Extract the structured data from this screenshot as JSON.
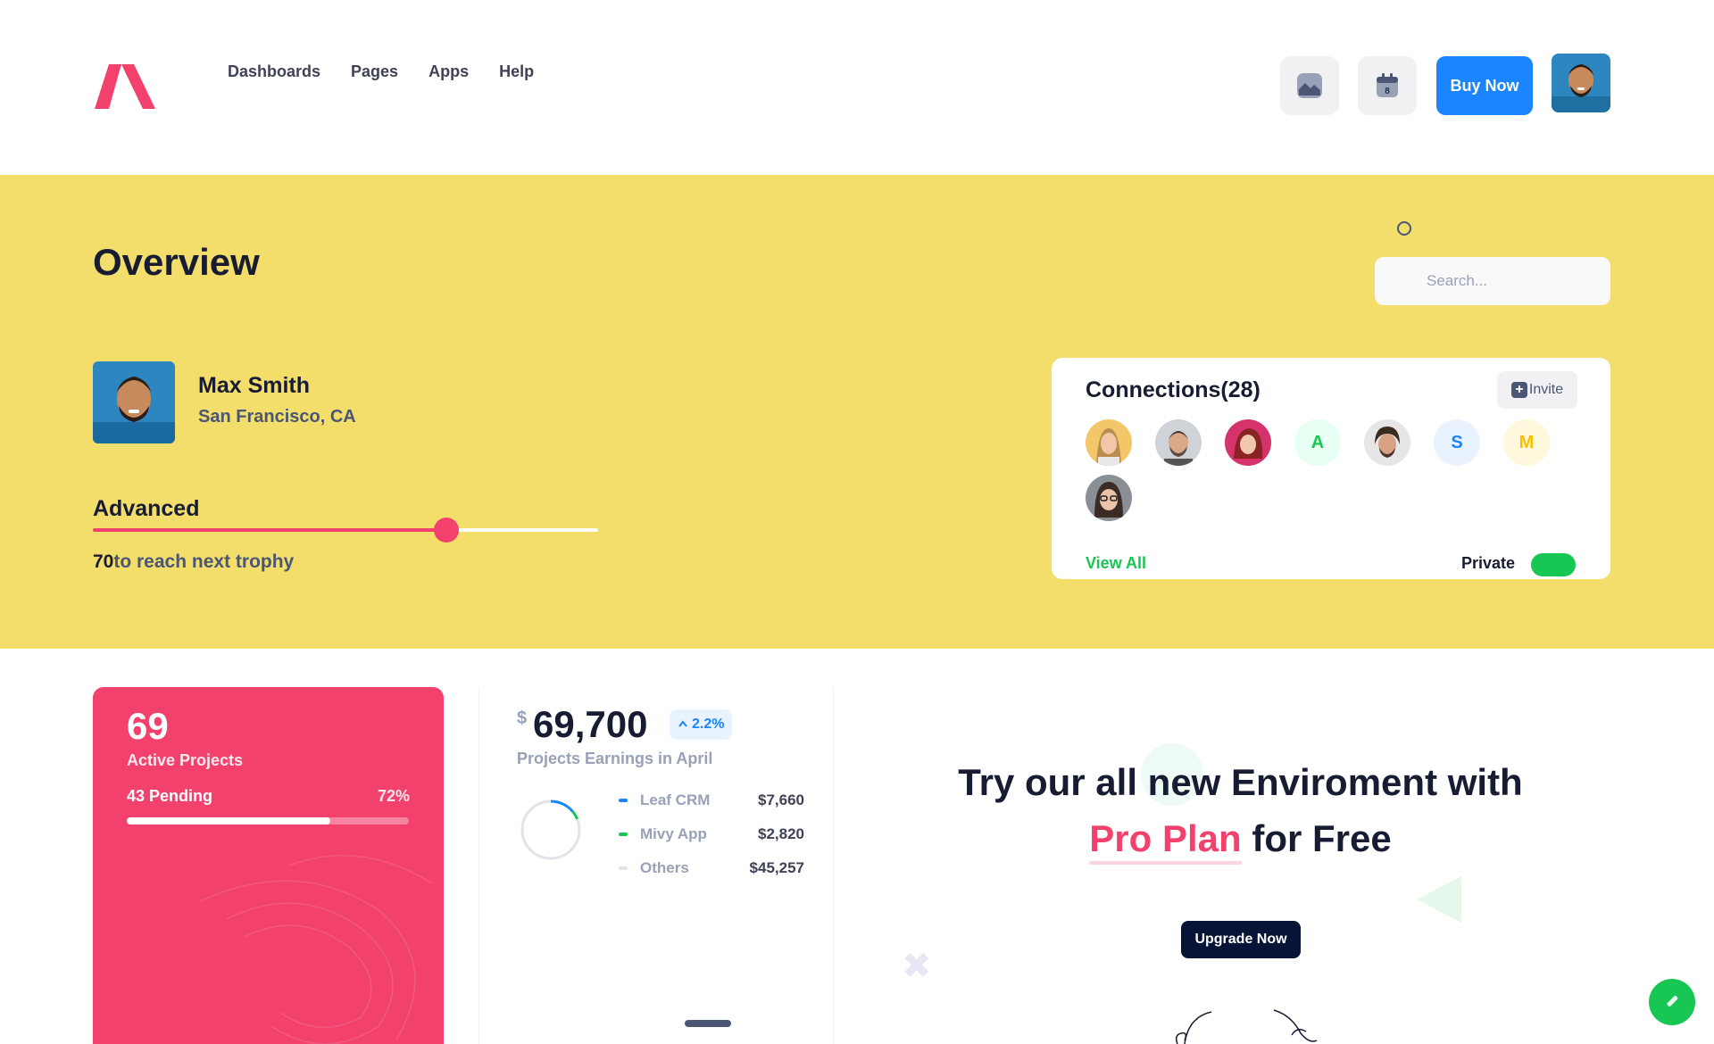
{
  "header": {
    "nav": [
      "Dashboards",
      "Pages",
      "Apps",
      "Help"
    ],
    "buy_label": "Buy Now",
    "calendar_day": "8"
  },
  "hero": {
    "title": "Overview",
    "search_placeholder": "Search...",
    "profile": {
      "name": "Max Smith",
      "location": "San Francisco, CA"
    },
    "level": {
      "label": "Advanced",
      "progress": 0.7,
      "points": "70",
      "points_suffix": "to reach next trophy"
    }
  },
  "connections": {
    "title": "Connections(28)",
    "invite_label": "Invite",
    "avatars": [
      {
        "type": "photo"
      },
      {
        "type": "photo"
      },
      {
        "type": "photo"
      },
      {
        "type": "initial",
        "initial": "A",
        "color": "#17c653",
        "bg": "#e8fff3"
      },
      {
        "type": "photo"
      },
      {
        "type": "initial",
        "initial": "S",
        "color": "#1b84ff",
        "bg": "#e9f3ff"
      },
      {
        "type": "initial",
        "initial": "M",
        "color": "#f6c000",
        "bg": "#fff8dd"
      },
      {
        "type": "photo"
      }
    ],
    "view_all": "View All",
    "private_label": "Private",
    "private_on": true
  },
  "projects": {
    "count": "69",
    "label": "Active Projects",
    "pending": "43 Pending",
    "percent": "72%",
    "progress": 0.72
  },
  "earnings": {
    "currency": "$",
    "amount": "69,700",
    "change": "2.2%",
    "label": "Projects Earnings in April",
    "items": [
      {
        "name": "Leaf CRM",
        "value": "$7,660",
        "color": "#1b84ff"
      },
      {
        "name": "Mivy App",
        "value": "$2,820",
        "color": "#17c653"
      },
      {
        "name": "Others",
        "value": "$45,257",
        "color": "#e1e3ea"
      }
    ]
  },
  "promo": {
    "line1": "Try our all new Enviroment with",
    "highlight": "Pro Plan",
    "line2_rest": " for Free",
    "button": "Upgrade Now"
  },
  "colors": {
    "brand_red": "#f1416c",
    "primary": "#1b84ff",
    "success": "#17c653",
    "hero_bg": "#f3dd6b"
  }
}
